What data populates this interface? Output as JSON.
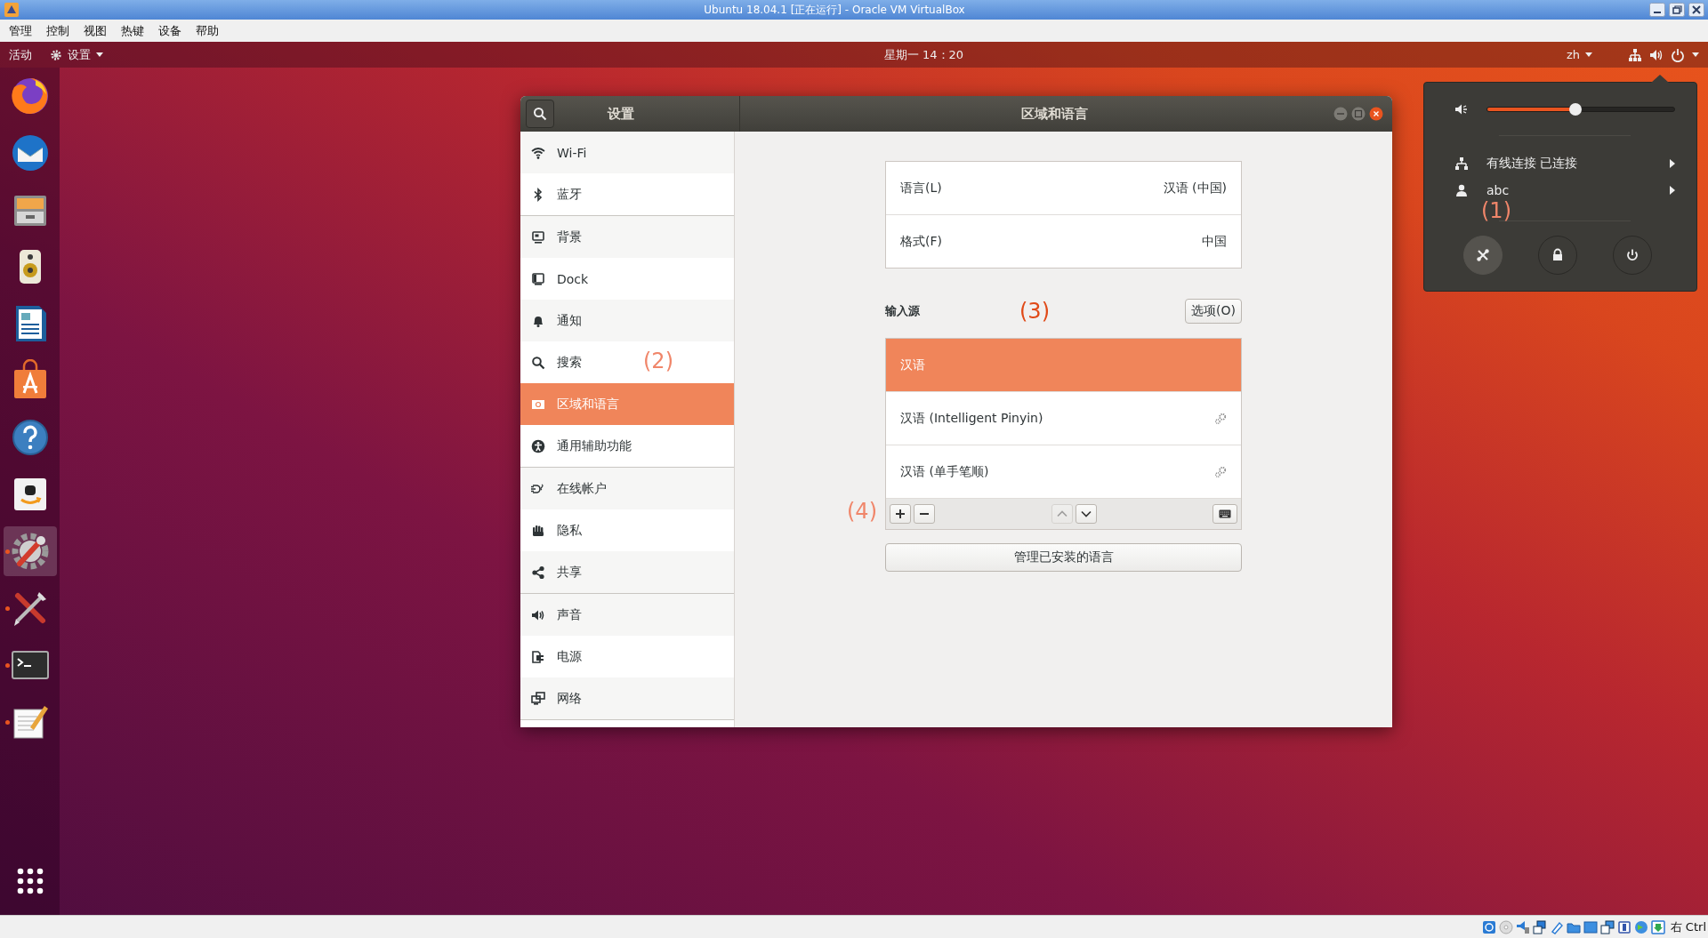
{
  "vbox": {
    "title": "Ubuntu 18.04.1 [正在运行] - Oracle VM VirtualBox",
    "menu": [
      "管理",
      "控制",
      "视图",
      "热键",
      "设备",
      "帮助"
    ],
    "host_key": "右 Ctrl"
  },
  "topbar": {
    "activities": "活动",
    "app_menu": "设置",
    "clock": "星期一 14：20",
    "input_method": "zh"
  },
  "dock": [
    {
      "kind": "firefox",
      "running": false,
      "selected": false
    },
    {
      "kind": "mail",
      "running": false,
      "selected": false
    },
    {
      "kind": "files",
      "running": false,
      "selected": false
    },
    {
      "kind": "music",
      "running": false,
      "selected": false
    },
    {
      "kind": "writer",
      "running": false,
      "selected": false
    },
    {
      "kind": "software",
      "running": false,
      "selected": false
    },
    {
      "kind": "help",
      "running": false,
      "selected": false
    },
    {
      "kind": "amazon",
      "running": false,
      "selected": false
    },
    {
      "kind": "settings",
      "running": true,
      "selected": true
    },
    {
      "kind": "tools",
      "running": true,
      "selected": false
    },
    {
      "kind": "terminal",
      "running": true,
      "selected": false
    },
    {
      "kind": "editor",
      "running": true,
      "selected": false
    }
  ],
  "settings": {
    "title": "设置",
    "panel_title": "区域和语言",
    "sidebar_annotation": "(2)",
    "sidebar": [
      {
        "items": [
          {
            "kind": "wifi",
            "label": "Wi-Fi",
            "selected": false
          },
          {
            "kind": "bluetooth",
            "label": "蓝牙",
            "selected": false
          }
        ]
      },
      {
        "items": [
          {
            "kind": "background",
            "label": "背景",
            "selected": false
          },
          {
            "kind": "dock",
            "label": "Dock",
            "selected": false
          },
          {
            "kind": "bell",
            "label": "通知",
            "selected": false
          },
          {
            "kind": "search",
            "label": "搜索",
            "selected": false
          },
          {
            "kind": "flag",
            "label": "区域和语言",
            "selected": true
          },
          {
            "kind": "accessibility",
            "label": "通用辅助功能",
            "selected": false
          }
        ]
      },
      {
        "items": [
          {
            "kind": "accounts",
            "label": "在线帐户",
            "selected": false
          },
          {
            "kind": "hand",
            "label": "隐私",
            "selected": false
          },
          {
            "kind": "share",
            "label": "共享",
            "selected": false
          }
        ]
      },
      {
        "items": [
          {
            "kind": "speaker",
            "label": "声音",
            "selected": false
          },
          {
            "kind": "power",
            "label": "电源",
            "selected": false
          },
          {
            "kind": "network",
            "label": "网络",
            "selected": false
          }
        ]
      }
    ],
    "language_rows": [
      {
        "label": "语言(L)",
        "value": "汉语 (中国)"
      },
      {
        "label": "格式(F)",
        "value": "中国"
      }
    ],
    "input_sources_label": "输入源",
    "input_sources_annotation": "(3)",
    "options_button": "选项(O)",
    "input_sources": [
      {
        "name": "汉语",
        "selected": true,
        "has_settings": false
      },
      {
        "name": "汉语 (Intelligent Pinyin)",
        "selected": false,
        "has_settings": true
      },
      {
        "name": "汉语 (单手笔顺)",
        "selected": false,
        "has_settings": true
      }
    ],
    "toolbar_annotation": "(4)",
    "toolbar": [
      {
        "kind": "add",
        "disabled": false
      },
      {
        "kind": "remove",
        "disabled": false
      },
      {
        "kind": "up",
        "disabled": true
      },
      {
        "kind": "down",
        "disabled": false
      },
      {
        "kind": "keyboard",
        "disabled": false
      }
    ],
    "manage_button": "管理已安装的语言"
  },
  "popup": {
    "volume": {
      "level": 0.47
    },
    "rows": [
      {
        "kind": "network",
        "label": "有线连接 已连接"
      },
      {
        "kind": "user",
        "label": "abc"
      }
    ],
    "annotation": "(1)",
    "buttons": [
      {
        "kind": "settings",
        "selected": true
      },
      {
        "kind": "lock",
        "selected": false
      },
      {
        "kind": "power",
        "selected": false
      }
    ]
  }
}
